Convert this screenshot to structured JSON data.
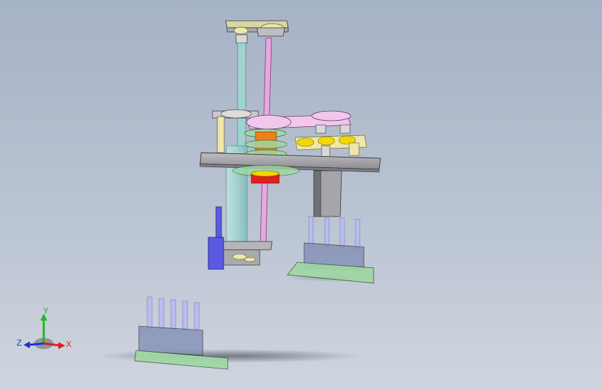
{
  "viewport": {
    "background_top": "#a6b2c6",
    "background_bottom": "#cfd5df"
  },
  "assembly": {
    "part_colors": {
      "frame_plate": "#a9a9ae",
      "rail": "#e7a8e0",
      "cylinder": "#9fd3d1",
      "gear": "#f07e1a",
      "yellow_gear": "#f0d800",
      "red_ring": "#e0201a",
      "blue_post": "#5a5ae0",
      "transparent_green": "#9fd8a2",
      "glass_tube": "#b9bdf0",
      "pale_yellow": "#efe7a8"
    }
  },
  "triad": {
    "x_label": "X",
    "y_label": "Y",
    "z_label": "Z",
    "x_color": "#d81e1e",
    "y_color": "#1fb81f",
    "z_color": "#1e2fd8"
  }
}
